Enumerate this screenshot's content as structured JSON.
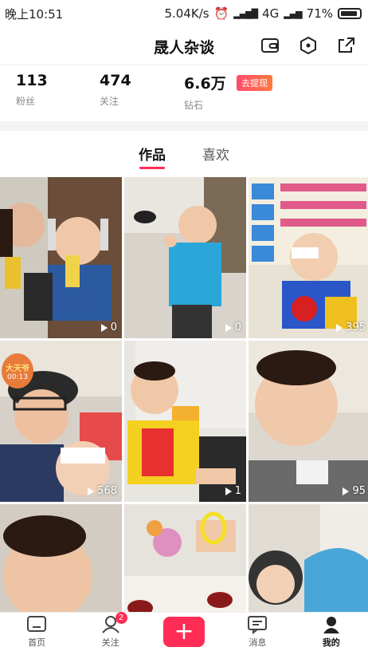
{
  "status": {
    "time": "晚上10:51",
    "speed": "5.04K/s",
    "network": "4G",
    "battery": "71%"
  },
  "header": {
    "title": "晟人杂谈"
  },
  "stats": {
    "fans": {
      "value": "113",
      "label": "粉丝"
    },
    "following": {
      "value": "474",
      "label": "关注"
    },
    "diamonds": {
      "value": "6.6万",
      "label": "钻石",
      "action": "去提现"
    }
  },
  "tabs": [
    {
      "label": "作品",
      "active": true
    },
    {
      "label": "喜欢",
      "active": false
    }
  ],
  "videos": [
    {
      "views": "0"
    },
    {
      "views": "0"
    },
    {
      "views": "395"
    },
    {
      "views": "568",
      "sticker_title": "大天爷",
      "sticker_time": "00:13"
    },
    {
      "views": "1"
    },
    {
      "views": "95"
    },
    {
      "views": ""
    },
    {
      "views": ""
    },
    {
      "views": ""
    }
  ],
  "nav": {
    "home": "首页",
    "follow": "关注",
    "follow_badge": "2",
    "create": "+",
    "messages": "消息",
    "me": "我的"
  },
  "colors": {
    "accent": "#ff2d55"
  }
}
